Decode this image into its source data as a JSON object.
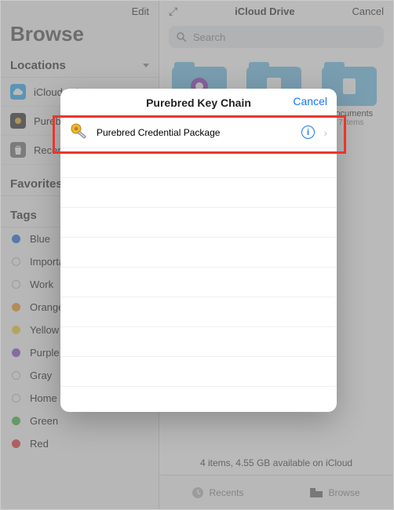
{
  "sidebar": {
    "edit": "Edit",
    "title": "Browse",
    "locations_header": "Locations",
    "items": [
      {
        "label": "iCloud Drive"
      },
      {
        "label": "Purebred"
      },
      {
        "label": "Recently Deleted"
      }
    ],
    "favorites_header": "Favorites",
    "tags_header": "Tags",
    "tags": [
      {
        "label": "Blue",
        "color": "#1f6fe0",
        "filled": true
      },
      {
        "label": "Important",
        "color": "#bbbbbb",
        "filled": false
      },
      {
        "label": "Work",
        "color": "#bbbbbb",
        "filled": false
      },
      {
        "label": "Orange",
        "color": "#f09a2a",
        "filled": true
      },
      {
        "label": "Yellow",
        "color": "#f2cf35",
        "filled": true
      },
      {
        "label": "Purple",
        "color": "#8d51c9",
        "filled": true
      },
      {
        "label": "Gray",
        "color": "#bbbbbb",
        "filled": false
      },
      {
        "label": "Home",
        "color": "#bbbbbb",
        "filled": false
      },
      {
        "label": "Green",
        "color": "#46b648",
        "filled": true
      },
      {
        "label": "Red",
        "color": "#e23a35",
        "filled": true
      }
    ]
  },
  "main": {
    "title": "iCloud Drive",
    "cancel": "Cancel",
    "search_placeholder": "Search",
    "folders": [
      {
        "name": "",
        "sub": "",
        "icon": "camera",
        "iconbg": "#8d3dbb"
      },
      {
        "name": "",
        "sub": "",
        "icon": "page",
        "iconbg": "#ffffff"
      },
      {
        "name": "Documents",
        "sub": "7 items",
        "icon": "doc",
        "iconbg": "#ffffff"
      }
    ],
    "status": "4 items, 4.55 GB available on iCloud",
    "tabs": {
      "recents": "Recents",
      "browse": "Browse"
    }
  },
  "modal": {
    "title": "Purebred Key Chain",
    "cancel": "Cancel",
    "item": "Purebred Credential Package"
  }
}
